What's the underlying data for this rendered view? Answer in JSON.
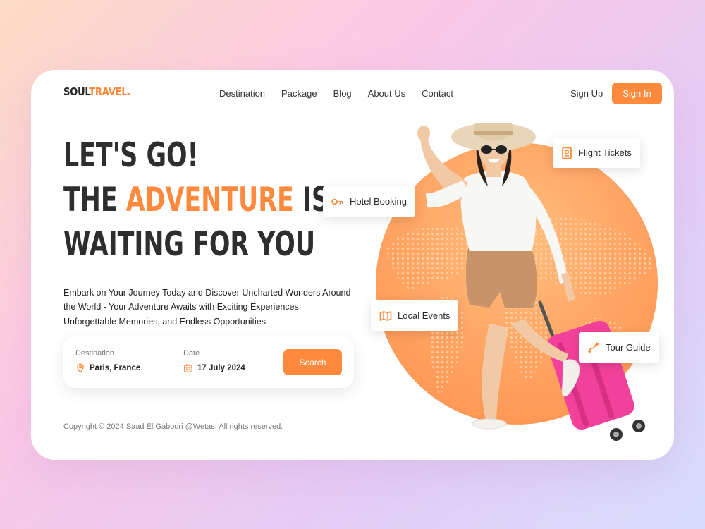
{
  "brand": {
    "part1": "SOUL",
    "part2": "TRAVEL",
    "suffix": "."
  },
  "nav": {
    "items": [
      "Destination",
      "Package",
      "Blog",
      "About Us",
      "Contact"
    ]
  },
  "auth": {
    "signup": "Sign Up",
    "signin": "Sign In"
  },
  "hero": {
    "line1": "LET'S GO!",
    "line2_start": "THE ",
    "line2_accent": "ADVENTURE",
    "line2_end": " IS",
    "line3": "WAITING FOR YOU",
    "description": "Embark on Your Journey Today and Discover Uncharted Wonders Around the World - Your Adventure Awaits with Exciting Experiences, Unforgettable Memories, and Endless Opportunities"
  },
  "search": {
    "destination_label": "Destination",
    "destination_value": "Paris, France",
    "date_label": "Date",
    "date_value": "17 July 2024",
    "button": "Search"
  },
  "footer": {
    "copyright": "Copyright © 2024 Saad El Gabouri @Wetas. All rights reserved."
  },
  "chips": {
    "hotel": "Hotel Booking",
    "flight": "Flight Tickets",
    "events": "Local Events",
    "guide": "Tour Guide"
  },
  "icons": {
    "destination": "location-pin-icon",
    "date": "calendar-icon",
    "hotel": "key-icon",
    "flight": "passport-icon",
    "events": "map-icon",
    "guide": "route-icon"
  },
  "colors": {
    "accent": "#ff8a3d",
    "text": "#2e2e2e",
    "suitcase": "#f2419a"
  }
}
